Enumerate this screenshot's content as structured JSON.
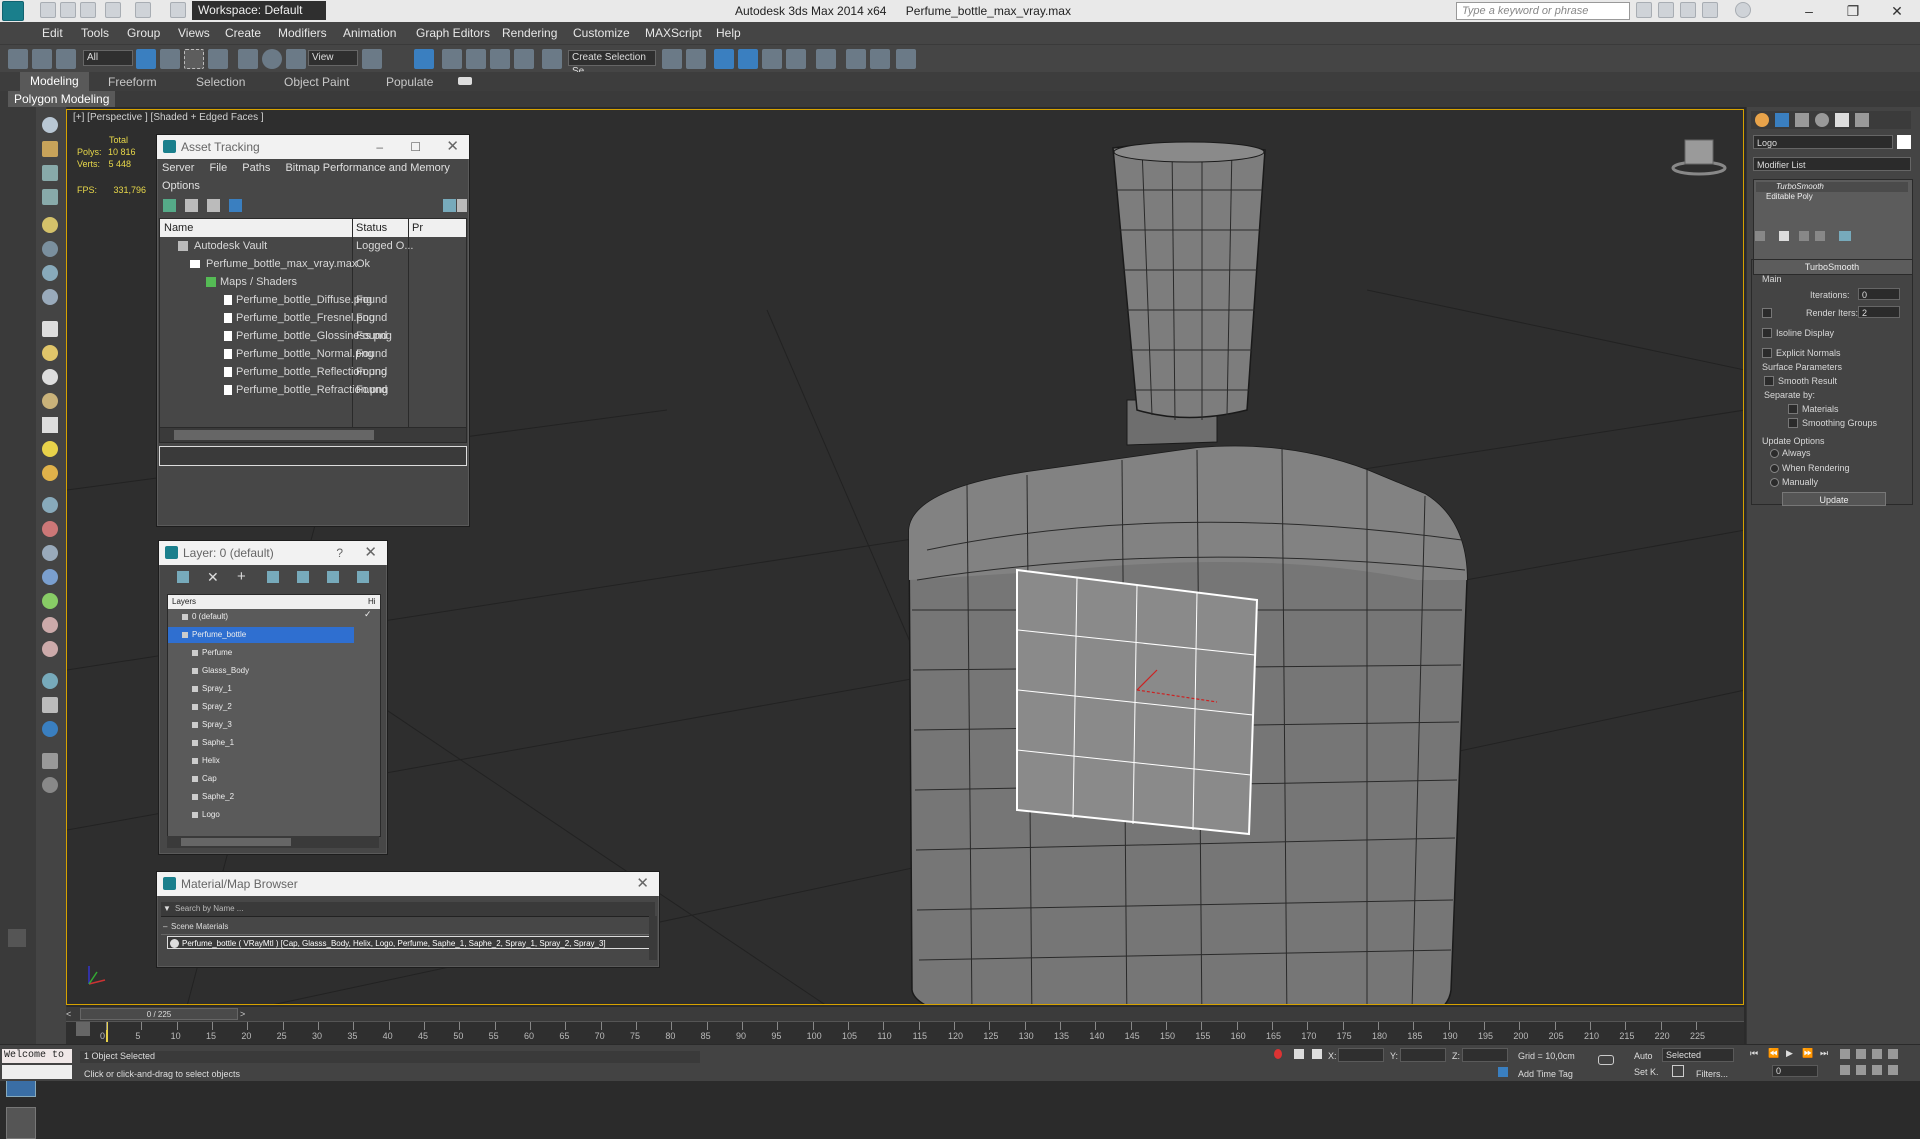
{
  "titlebar": {
    "app_title": "Autodesk 3ds Max  2014 x64",
    "file_title": "Perfume_bottle_max_vray.max",
    "workspace": "Workspace: Default",
    "search_placeholder": "Type a keyword or phrase"
  },
  "menu": [
    "Edit",
    "Tools",
    "Group",
    "Views",
    "Create",
    "Modifiers",
    "Animation",
    "Graph Editors",
    "Rendering",
    "Customize",
    "MAXScript",
    "Help"
  ],
  "toolbar": {
    "selection_filter": "All",
    "ref_coord": "View",
    "named_selection": "Create Selection Se"
  },
  "ribbon": {
    "tabs": [
      "Modeling",
      "Freeform",
      "Selection",
      "Object Paint",
      "Populate"
    ],
    "active_panel": "Polygon Modeling"
  },
  "viewport": {
    "label": "[+] [Perspective ] [Shaded + Edged Faces ]",
    "stats_header": "Total",
    "polys_label": "Polys:",
    "polys_value": "10 816",
    "verts_label": "Verts:",
    "verts_value": "5 448",
    "fps_label": "FPS:",
    "fps_value": "331,796"
  },
  "asset_tracking": {
    "title": "Asset Tracking",
    "menu": [
      "Server",
      "File",
      "Paths",
      "Bitmap Performance and Memory"
    ],
    "menu2": "Options",
    "columns": [
      "Name",
      "Status",
      "Pr"
    ],
    "rows": [
      {
        "name": "Autodesk Vault",
        "status": "Logged O..."
      },
      {
        "name": "Perfume_bottle_max_vray.max",
        "status": "Ok"
      },
      {
        "name": "Maps / Shaders",
        "status": ""
      },
      {
        "name": "Perfume_bottle_Diffuse.png",
        "status": "Found"
      },
      {
        "name": "Perfume_bottle_Fresnel.png",
        "status": "Found"
      },
      {
        "name": "Perfume_bottle_Glossiness.png",
        "status": "Found"
      },
      {
        "name": "Perfume_bottle_Normal.png",
        "status": "Found"
      },
      {
        "name": "Perfume_bottle_Reflection.png",
        "status": "Found"
      },
      {
        "name": "Perfume_bottle_Refraction.png",
        "status": "Found"
      }
    ]
  },
  "layer_panel": {
    "title": "Layer: 0 (default)",
    "help": "?",
    "header_layers": "Layers",
    "header_hide": "Hi",
    "layers": [
      "0 (default)",
      "Perfume_bottle",
      "Perfume",
      "Glasss_Body",
      "Spray_1",
      "Spray_2",
      "Spray_3",
      "Saphe_1",
      "Helix",
      "Cap",
      "Saphe_2",
      "Logo"
    ]
  },
  "material_browser": {
    "title": "Material/Map Browser",
    "search_placeholder": "Search by Name ...",
    "group": "Scene Materials",
    "item": "Perfume_bottle  ( VRayMtl ) [Cap, Glasss_Body, Helix, Logo, Perfume, Saphe_1, Saphe_2, Spray_1, Spray_2, Spray_3]"
  },
  "command_panel": {
    "object_name": "Logo",
    "modifier_list": "Modifier List",
    "stack": [
      "TurboSmooth",
      "Editable Poly"
    ],
    "rollout": "TurboSmooth",
    "main": "Main",
    "iterations_label": "Iterations:",
    "iterations": "0",
    "render_iters_label": "Render Iters:",
    "render_iters": "2",
    "isoline": "Isoline Display",
    "explicit": "Explicit Normals",
    "surface": "Surface Parameters",
    "smooth_result": "Smooth Result",
    "separate": "Separate by:",
    "materials": "Materials",
    "smoothing": "Smoothing Groups",
    "update_options": "Update Options",
    "always": "Always",
    "when_rendering": "When Rendering",
    "manually": "Manually",
    "update_btn": "Update"
  },
  "timeline": {
    "frame": "0 / 225",
    "ticks": [
      "0",
      "5",
      "10",
      "15",
      "20",
      "25",
      "30",
      "35",
      "40",
      "45",
      "50",
      "55",
      "60",
      "65",
      "70",
      "75",
      "80",
      "85",
      "90",
      "95",
      "100",
      "105",
      "110",
      "115",
      "120",
      "125",
      "130",
      "135",
      "140",
      "145",
      "150",
      "155",
      "160",
      "165",
      "170",
      "175",
      "180",
      "185",
      "190",
      "195",
      "200",
      "205",
      "210",
      "215",
      "220",
      "225"
    ]
  },
  "status": {
    "welcome": "Welcome to",
    "selection": "1 Object Selected",
    "prompt": "Click or click-and-drag to select objects",
    "x_label": "X:",
    "y_label": "Y:",
    "z_label": "Z:",
    "grid": "Grid = 10,0cm",
    "auto": "Auto",
    "set_key": "Set K.",
    "selected": "Selected",
    "filters": "Filters...",
    "add_time_tag": "Add Time Tag",
    "frame_field": "0"
  }
}
